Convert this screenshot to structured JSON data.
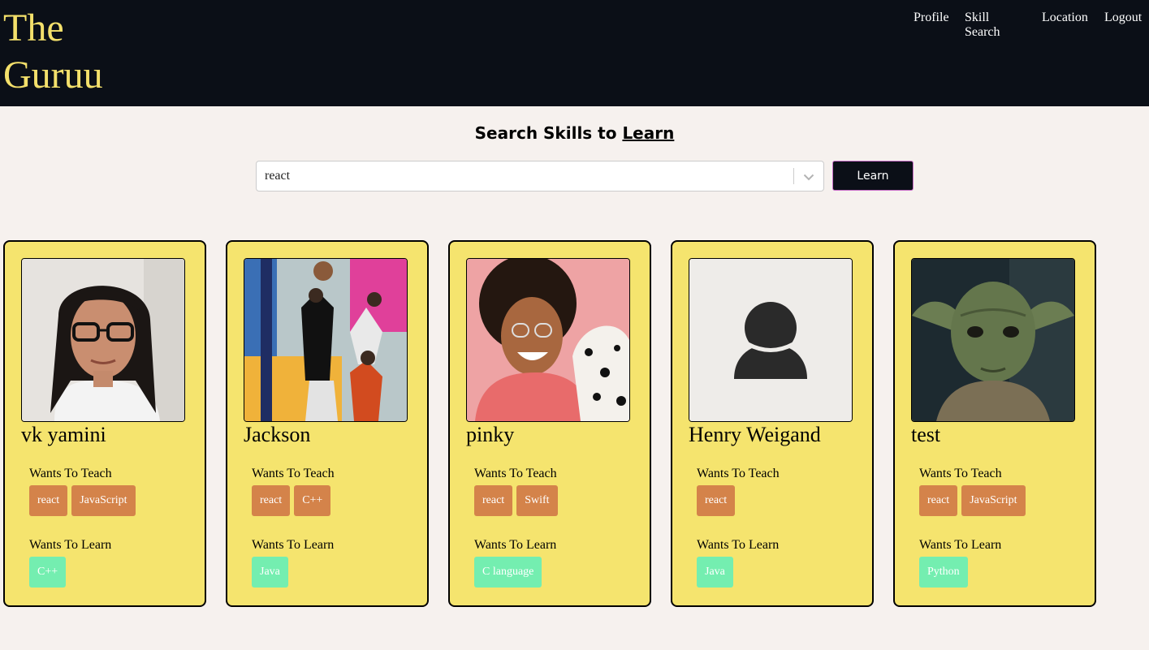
{
  "app": {
    "brand": "The Guruu"
  },
  "nav": [
    {
      "label": "Profile"
    },
    {
      "label": "Skill Search"
    },
    {
      "label": "Location"
    },
    {
      "label": "Logout"
    }
  ],
  "search": {
    "title_prefix": "Search Skills to ",
    "title_link": "Learn",
    "selected_value": "react",
    "button_label": "Learn"
  },
  "labels": {
    "teach": "Wants To Teach",
    "learn": "Wants To Learn"
  },
  "colors": {
    "header_bg": "#0b0f17",
    "brand": "#f4e06b",
    "card_bg": "#f5e46e",
    "teach_chip": "#d4834a",
    "learn_chip": "#74eeb0"
  },
  "profiles": [
    {
      "name": "vk yamini",
      "teach": [
        "react",
        "JavaScript"
      ],
      "learn": [
        "C++"
      ],
      "photo": "woman-glasses-photo"
    },
    {
      "name": "Jackson",
      "teach": [
        "react",
        "C++"
      ],
      "learn": [
        "Java"
      ],
      "photo": "basketball-photo"
    },
    {
      "name": "pinky",
      "teach": [
        "react",
        "Swift"
      ],
      "learn": [
        "C language"
      ],
      "photo": "smiling-woman-dog-photo"
    },
    {
      "name": "Henry Weigand",
      "teach": [
        "react"
      ],
      "learn": [
        "Java"
      ],
      "photo": "default-avatar-icon"
    },
    {
      "name": "test",
      "teach": [
        "react",
        "JavaScript"
      ],
      "learn": [
        "Python"
      ],
      "photo": "yoda-photo"
    }
  ]
}
